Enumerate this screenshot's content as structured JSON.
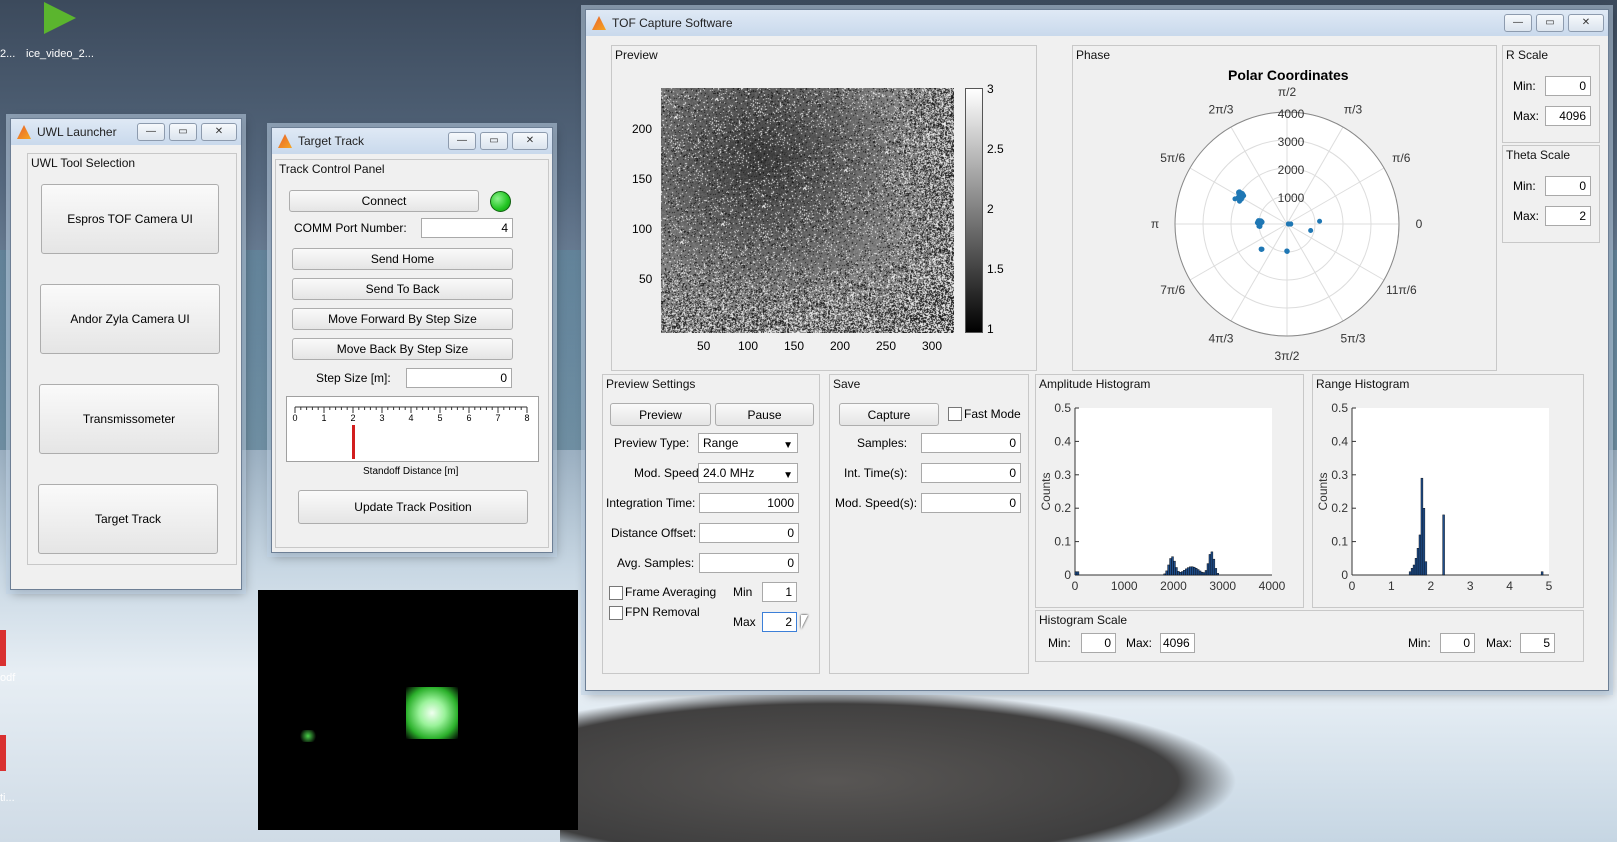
{
  "desktop": {
    "icons": [
      {
        "label": "2..."
      },
      {
        "label": "ice_video_2..."
      },
      {
        "label": "odf"
      },
      {
        "label": "ti..."
      }
    ]
  },
  "uwl_launcher": {
    "title": "UWL Launcher",
    "panel_title": "UWL Tool Selection",
    "buttons": [
      "Espros TOF Camera UI",
      "Andor Zyla Camera UI",
      "Transmissometer",
      "Target Track"
    ]
  },
  "target_track": {
    "title": "Target Track",
    "panel_title": "Track Control Panel",
    "connect_label": "Connect",
    "comm_port_label": "COMM Port Number:",
    "comm_port_value": "4",
    "send_home_label": "Send Home",
    "send_back_label": "Send To Back",
    "move_forward_label": "Move Forward By Step Size",
    "move_back_label": "Move Back By Step Size",
    "step_size_label": "Step Size [m]:",
    "step_size_value": "0",
    "slider_ticks": [
      "0",
      "1",
      "2",
      "3",
      "4",
      "5",
      "6",
      "7",
      "8"
    ],
    "slider_value": 2,
    "slider_caption": "Standoff Distance [m]",
    "update_label": "Update Track Position",
    "status_color": "#22c522"
  },
  "tof": {
    "title": "TOF Capture Software",
    "preview": {
      "panel_title": "Preview",
      "y_ticks": [
        "200",
        "150",
        "100",
        "50"
      ],
      "x_ticks": [
        "50",
        "100",
        "150",
        "200",
        "250",
        "300"
      ],
      "colorbar_ticks": [
        "3",
        "2.5",
        "2",
        "1.5",
        "1"
      ]
    },
    "phase": {
      "panel_title": "Phase",
      "plot_title": "Polar Coordinates",
      "angle_labels": [
        "π/2",
        "π/3",
        "π/6",
        "0",
        "11π/6",
        "5π/3",
        "3π/2",
        "4π/3",
        "7π/6",
        "π",
        "5π/6",
        "2π/3"
      ],
      "r_labels": [
        "4000",
        "3000",
        "2000",
        "1000"
      ],
      "point_color": "#1f77b4"
    },
    "r_scale": {
      "panel_title": "R Scale",
      "min_label": "Min:",
      "min_value": "0",
      "max_label": "Max:",
      "max_value": "4096"
    },
    "theta_scale": {
      "panel_title": "Theta Scale",
      "min_label": "Min:",
      "min_value": "0",
      "max_label": "Max:",
      "max_value": "2"
    },
    "preview_settings": {
      "panel_title": "Preview Settings",
      "preview_label": "Preview",
      "pause_label": "Pause",
      "preview_type_label": "Preview Type:",
      "preview_type_value": "Range",
      "mod_speed_label": "Mod. Speed:",
      "mod_speed_value": "24.0 MHz",
      "integration_time_label": "Integration Time:",
      "integration_time_value": "1000",
      "distance_offset_label": "Distance Offset:",
      "distance_offset_value": "0",
      "avg_samples_label": "Avg. Samples:",
      "avg_samples_value": "0",
      "frame_averaging_label": "Frame Averaging",
      "fpn_removal_label": "FPN Removal",
      "min_label": "Min",
      "min_value": "1",
      "max_label": "Max",
      "max_value": "2"
    },
    "save": {
      "panel_title": "Save",
      "capture_label": "Capture",
      "fast_mode_label": "Fast Mode",
      "samples_label": "Samples:",
      "samples_value": "0",
      "int_time_label": "Int. Time(s):",
      "int_time_value": "0",
      "mod_speed_label": "Mod. Speed(s):",
      "mod_speed_value": "0"
    },
    "amplitude_histogram": {
      "panel_title": "Amplitude Histogram",
      "ylabel": "Counts",
      "y_ticks": [
        "0.5",
        "0.4",
        "0.3",
        "0.2",
        "0.1",
        "0"
      ],
      "x_ticks": [
        "0",
        "1000",
        "2000",
        "3000",
        "4000"
      ]
    },
    "range_histogram": {
      "panel_title": "Range Histogram",
      "ylabel": "Counts",
      "y_ticks": [
        "0.5",
        "0.4",
        "0.3",
        "0.2",
        "0.1",
        "0"
      ],
      "x_ticks": [
        "0",
        "1",
        "2",
        "3",
        "4",
        "5"
      ]
    },
    "histogram_scale": {
      "panel_title": "Histogram Scale",
      "min_label": "Min:",
      "min_value": "0",
      "max_label": "Max:",
      "max_value": "4096",
      "min2_label": "Min:",
      "min2_value": "0",
      "max2_label": "Max:",
      "max2_value": "5"
    }
  }
}
